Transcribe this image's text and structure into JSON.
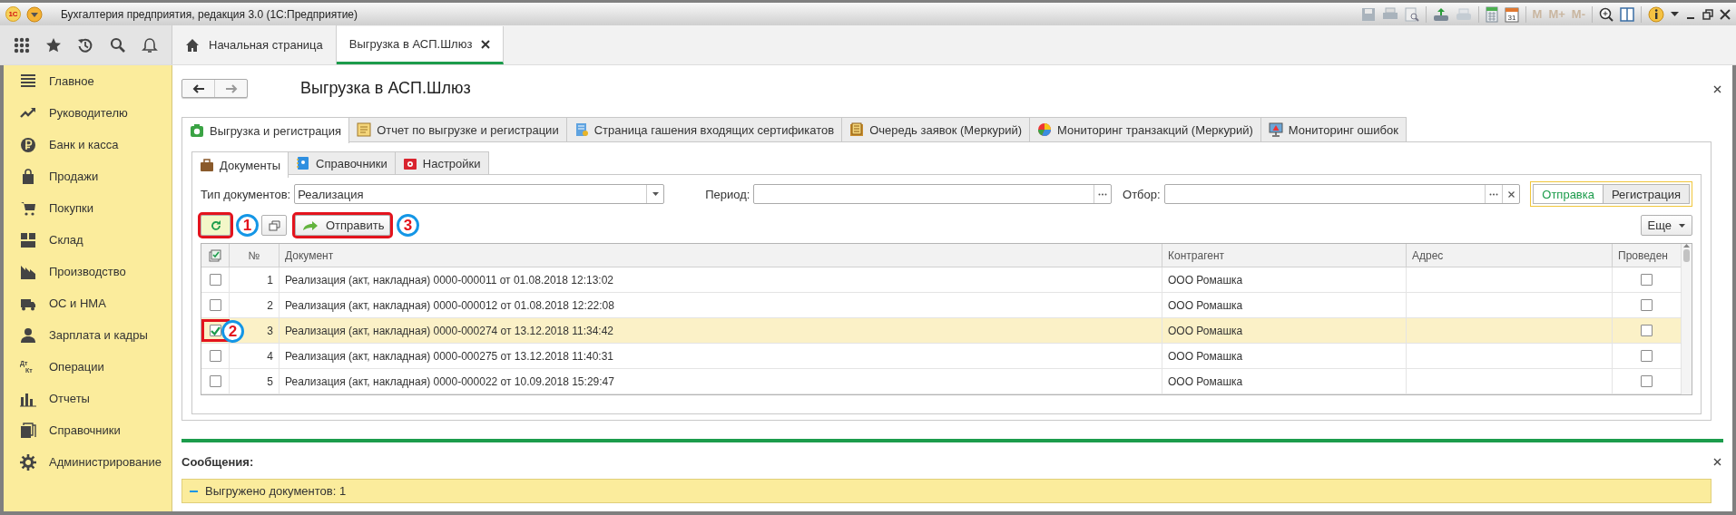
{
  "window": {
    "title": "Бухгалтерия предприятия, редакция 3.0  (1С:Предприятие)",
    "logo": "1С"
  },
  "title_toolbar": {
    "calendar_day": "31",
    "memory_buttons": [
      "M",
      "M+",
      "M-"
    ]
  },
  "section_tabs": [
    {
      "label": "Начальная страница",
      "selected": false
    },
    {
      "label": "Выгрузка в АСП.Шлюз",
      "selected": true
    }
  ],
  "sidebar": {
    "items": [
      {
        "label": "Главное"
      },
      {
        "label": "Руководителю"
      },
      {
        "label": "Банк и касса"
      },
      {
        "label": "Продажи"
      },
      {
        "label": "Покупки"
      },
      {
        "label": "Склад"
      },
      {
        "label": "Производство"
      },
      {
        "label": "ОС и НМА"
      },
      {
        "label": "Зарплата и кадры"
      },
      {
        "label": "Операции",
        "icon_text": [
          "Дт",
          "Кт"
        ]
      },
      {
        "label": "Отчеты"
      },
      {
        "label": "Справочники"
      },
      {
        "label": "Администрирование"
      }
    ]
  },
  "form": {
    "title": "Выгрузка в АСП.Шлюз",
    "tabs": [
      {
        "label": "Выгрузка и регистрация",
        "selected": true
      },
      {
        "label": "Отчет по выгрузке и регистрации",
        "selected": false
      },
      {
        "label": "Страница гашения входящих сертификатов",
        "selected": false
      },
      {
        "label": "Очередь заявок (Меркурий)",
        "selected": false
      },
      {
        "label": "Мониторинг транзакций (Меркурий)",
        "selected": false
      },
      {
        "label": "Мониторинг ошибок",
        "selected": false
      }
    ],
    "subtabs": [
      {
        "label": "Документы",
        "selected": true
      },
      {
        "label": "Справочники",
        "selected": false
      },
      {
        "label": "Настройки",
        "selected": false
      }
    ],
    "filters": [
      {
        "kind": "select",
        "label": "Тип документов:",
        "value": "Реализация"
      },
      {
        "kind": "choice",
        "label": "Период:"
      },
      {
        "kind": "clearable",
        "label": "Отбор:"
      }
    ],
    "mode_switch": [
      {
        "label": "Отправка",
        "selected": true
      },
      {
        "label": "Регистрация",
        "selected": false
      }
    ],
    "toolbar": {
      "refresh": {
        "marked": true,
        "badge": "1"
      },
      "send": {
        "label": "Отправить",
        "marked": true,
        "badge": "3"
      },
      "more": {
        "label": "Еще"
      }
    },
    "table": {
      "columns": [
        "№",
        "Документ",
        "Контрагент",
        "Адрес",
        "Проведен"
      ],
      "rows": [
        {
          "selected": false,
          "checked": false,
          "marked": false,
          "number": "1",
          "document": "Реализация (акт, накладная) 0000-000011 от 01.08.2018 12:13:02",
          "counterparty": "ООО Ромашка",
          "posted": false
        },
        {
          "selected": false,
          "checked": false,
          "marked": false,
          "number": "2",
          "document": "Реализация (акт, накладная) 0000-000012 от 01.08.2018 12:22:08",
          "counterparty": "ООО Ромашка",
          "posted": false
        },
        {
          "selected": true,
          "checked": true,
          "marked": true,
          "badge": "2",
          "number": "3",
          "document": "Реализация (акт, накладная) 0000-000274 от 13.12.2018 11:34:42",
          "counterparty": "ООО Ромашка",
          "posted": false
        },
        {
          "selected": false,
          "checked": false,
          "marked": false,
          "number": "4",
          "document": "Реализация (акт, накладная) 0000-000275 от 13.12.2018 11:40:31",
          "counterparty": "ООО Ромашка",
          "posted": false
        },
        {
          "selected": false,
          "checked": false,
          "marked": false,
          "number": "5",
          "document": "Реализация (акт, накладная) 0000-000022 от 10.09.2018 15:29:47",
          "counterparty": "ООО Ромашка",
          "posted": false
        }
      ]
    }
  },
  "messages": {
    "title": "Сообщения:",
    "items": [
      "Выгружено документов: 1"
    ]
  }
}
